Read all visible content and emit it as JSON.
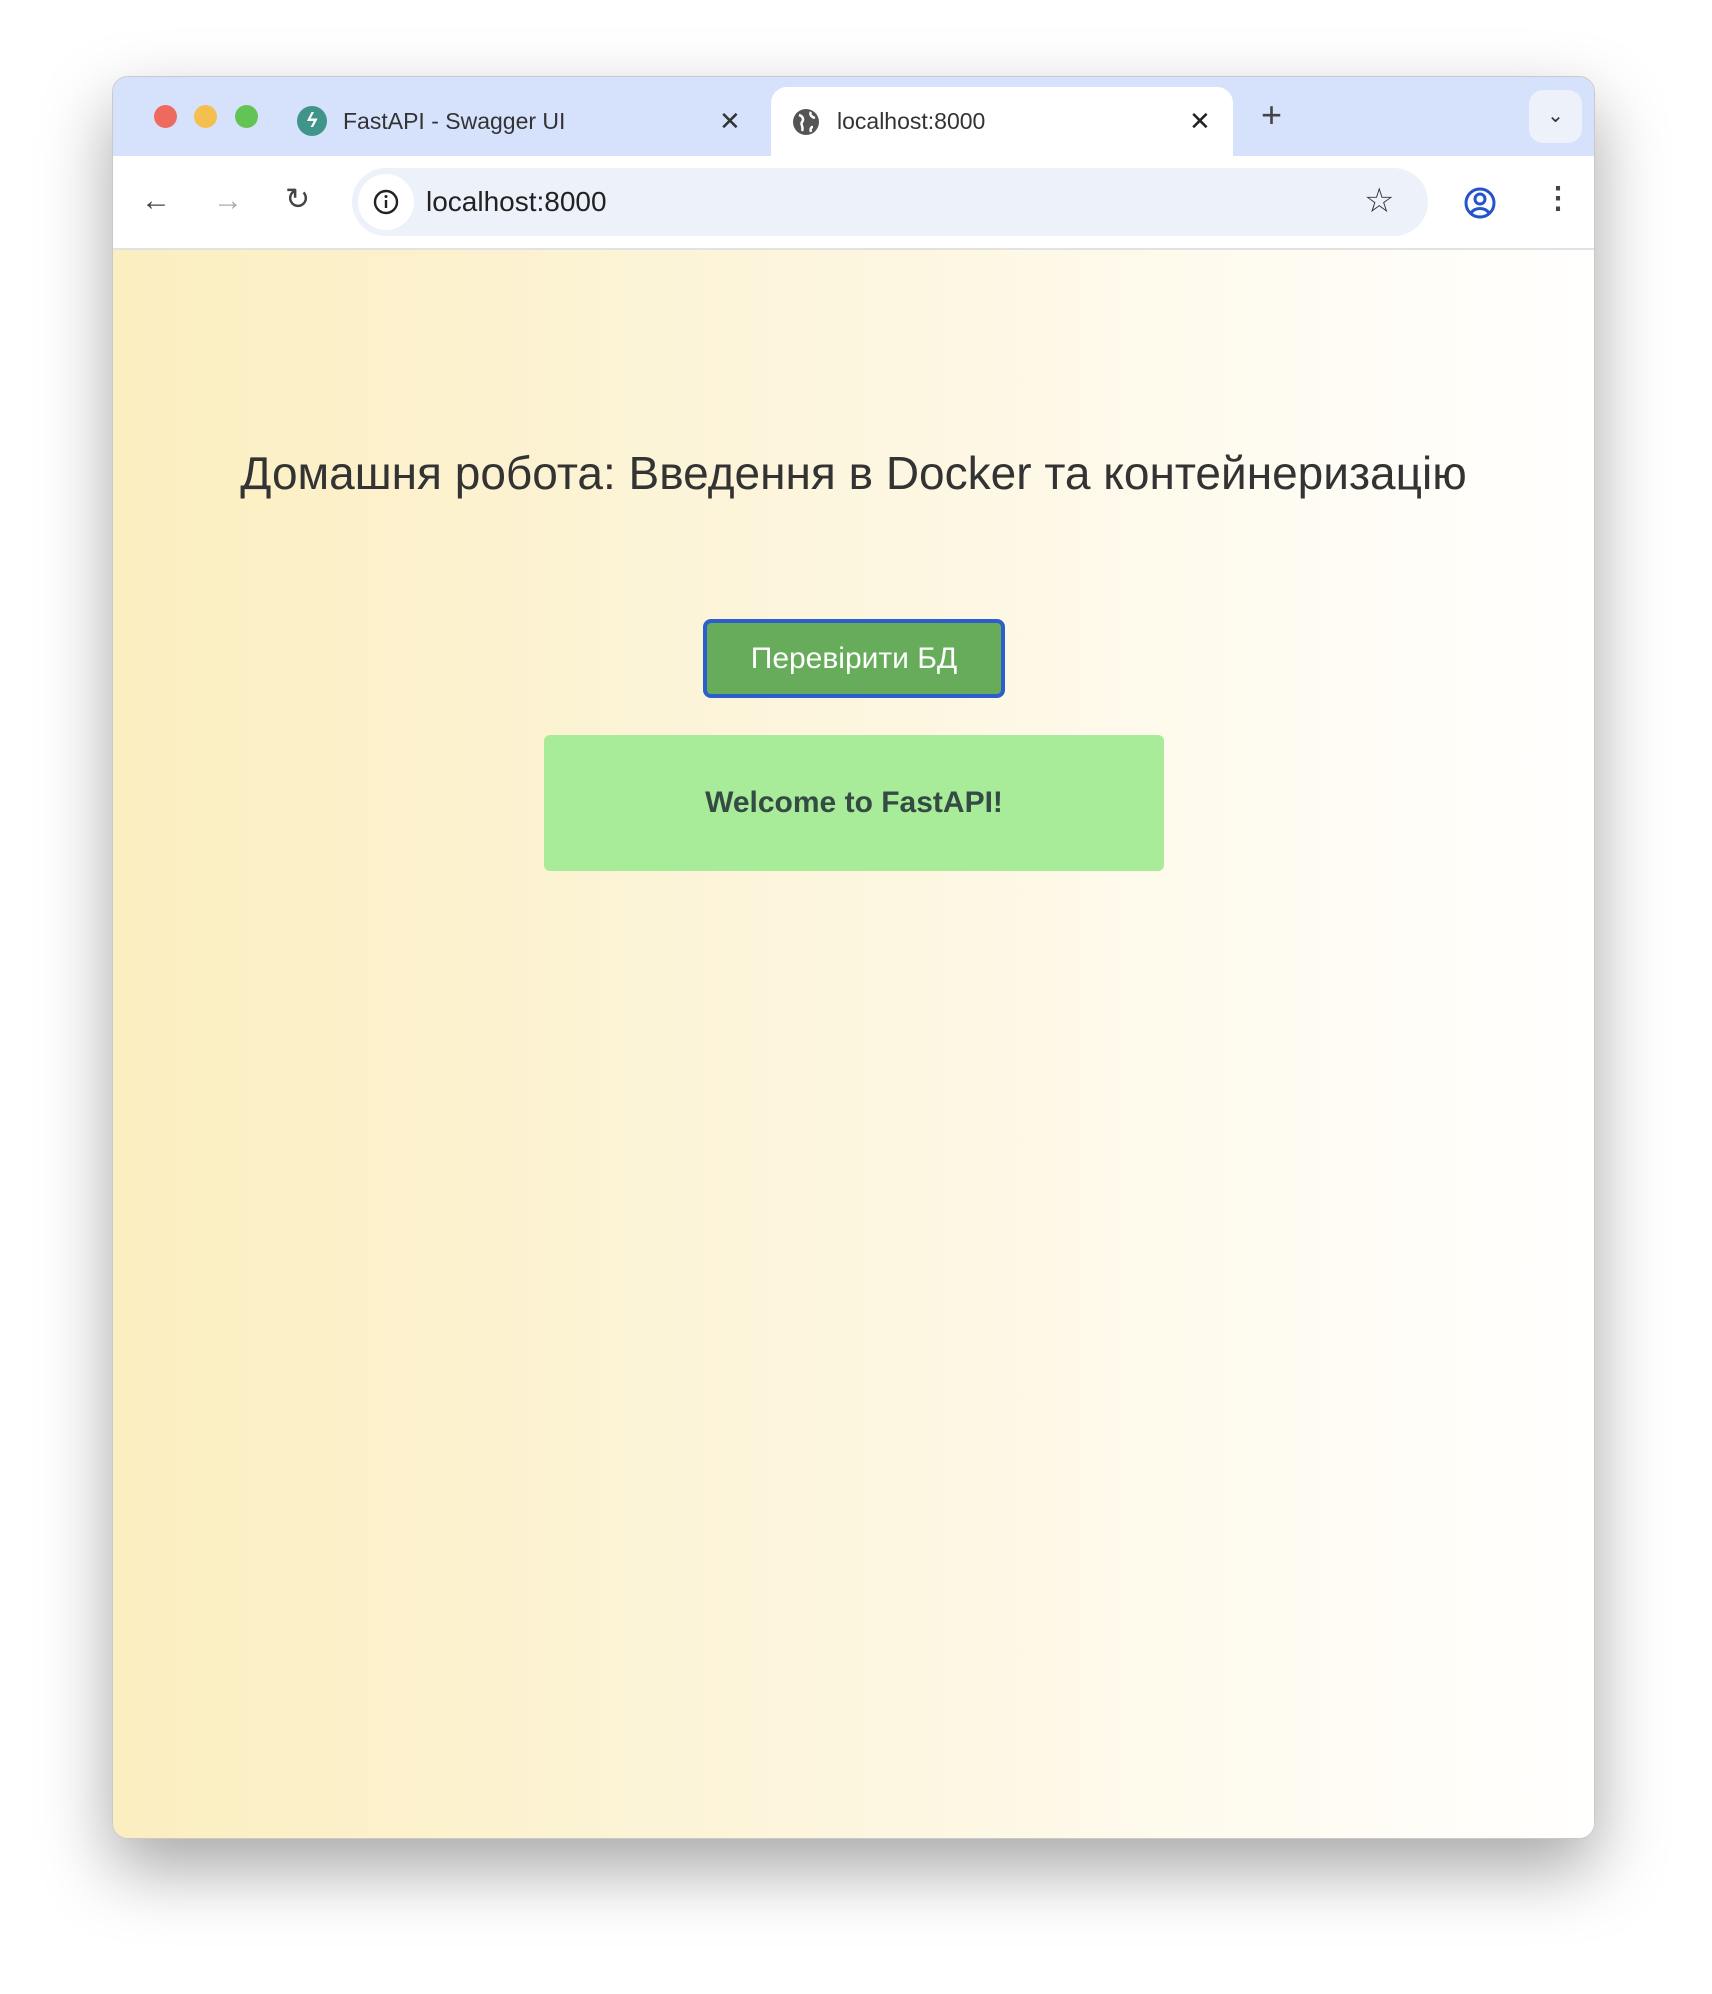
{
  "browser": {
    "tabs": [
      {
        "title": "FastAPI - Swagger UI",
        "icon": "fastapi-icon",
        "active": false
      },
      {
        "title": "localhost:8000",
        "icon": "globe-icon",
        "active": true
      }
    ],
    "address": "localhost:8000"
  },
  "page": {
    "title": "Домашня робота: Введення в Docker та контейнеризацію",
    "check_db_button": "Перевірити БД",
    "message": "Welcome to FastAPI!"
  },
  "colors": {
    "button": "#67ac5b",
    "button_border": "#2c5fcc",
    "message_bg": "#a8ec9a"
  }
}
